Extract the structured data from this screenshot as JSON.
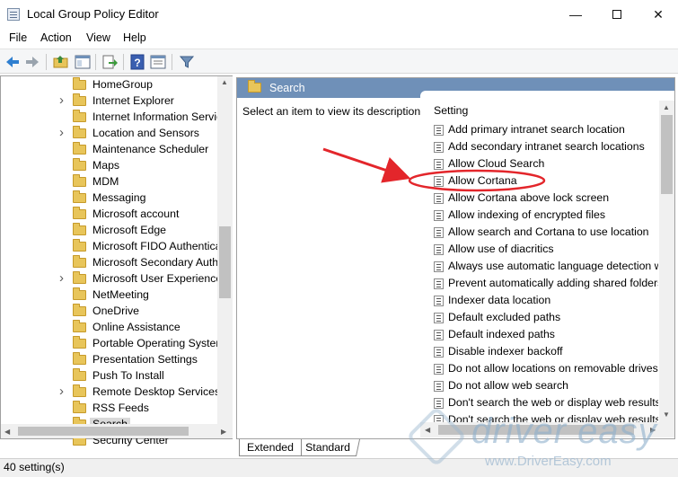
{
  "window": {
    "title": "Local Group Policy Editor",
    "min_glyph": "—",
    "close_glyph": "✕"
  },
  "menu": [
    "File",
    "Action",
    "View",
    "Help"
  ],
  "toolbar": {
    "icons": [
      "back-icon",
      "forward-icon",
      "up-folder-icon",
      "show-hide-tree-icon",
      "export-list-icon",
      "help-icon",
      "properties-icon",
      "filter-icon"
    ]
  },
  "tree": {
    "items": [
      {
        "label": "HomeGroup",
        "expandable": false
      },
      {
        "label": "Internet Explorer",
        "expandable": true
      },
      {
        "label": "Internet Information Servic",
        "expandable": false
      },
      {
        "label": "Location and Sensors",
        "expandable": true
      },
      {
        "label": "Maintenance Scheduler",
        "expandable": false
      },
      {
        "label": "Maps",
        "expandable": false
      },
      {
        "label": "MDM",
        "expandable": false
      },
      {
        "label": "Messaging",
        "expandable": false
      },
      {
        "label": "Microsoft account",
        "expandable": false
      },
      {
        "label": "Microsoft Edge",
        "expandable": false
      },
      {
        "label": "Microsoft FIDO Authentica",
        "expandable": false
      },
      {
        "label": "Microsoft Secondary Auth",
        "expandable": false
      },
      {
        "label": "Microsoft User Experience",
        "expandable": true
      },
      {
        "label": "NetMeeting",
        "expandable": false
      },
      {
        "label": "OneDrive",
        "expandable": false
      },
      {
        "label": "Online Assistance",
        "expandable": false
      },
      {
        "label": "Portable Operating System",
        "expandable": false
      },
      {
        "label": "Presentation Settings",
        "expandable": false
      },
      {
        "label": "Push To Install",
        "expandable": false
      },
      {
        "label": "Remote Desktop Services",
        "expandable": true
      },
      {
        "label": "RSS Feeds",
        "expandable": false
      },
      {
        "label": "Search",
        "expandable": false,
        "selected": true
      },
      {
        "label": "Security Center",
        "expandable": false
      }
    ]
  },
  "right": {
    "header": "Search",
    "description": "Select an item to view its description.",
    "column_header": "Setting",
    "settings": [
      "Add primary intranet search location",
      "Add secondary intranet search locations",
      "Allow Cloud Search",
      "Allow Cortana",
      "Allow Cortana above lock screen",
      "Allow indexing of encrypted files",
      "Allow search and Cortana to use location",
      "Allow use of diacritics",
      "Always use automatic language detection wh",
      "Prevent automatically adding shared folders",
      "Indexer data location",
      "Default excluded paths",
      "Default indexed paths",
      "Disable indexer backoff",
      "Do not allow locations on removable drives t",
      "Do not allow web search",
      "Don't search the web or display web results i",
      "Don't search the web or display web results i"
    ]
  },
  "tabs": [
    "Extended",
    "Standard"
  ],
  "status": "40 setting(s)",
  "annotation_color": "#e3262b",
  "watermark": {
    "name": "driver easy",
    "url": "www.DriverEasy.com"
  }
}
